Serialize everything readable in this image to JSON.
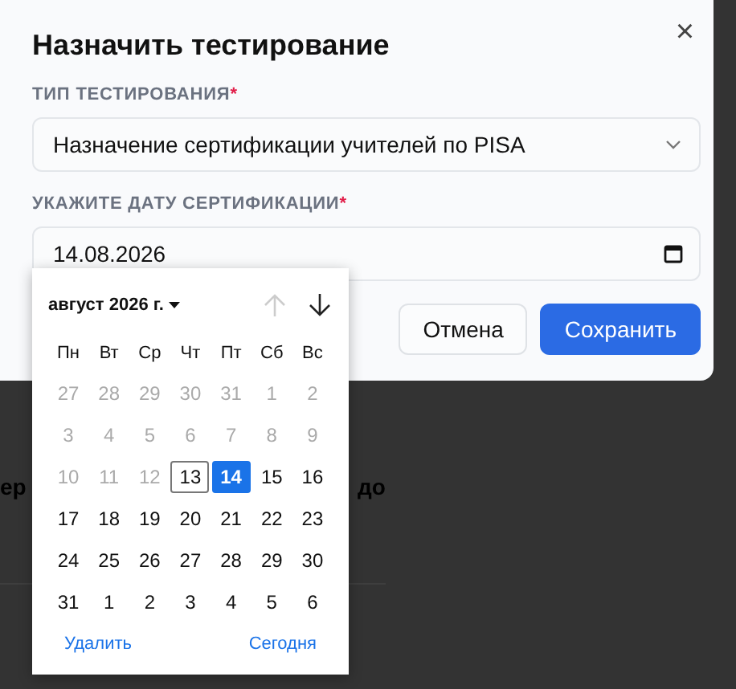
{
  "dialog": {
    "title": "Назначить тестирование",
    "close": "×",
    "fields": [
      {
        "label": "ТИП ТЕСТИРОВАНИЯ",
        "required_mark": "*",
        "kind": "select",
        "value": "Назначение сертификации учителей по PISA"
      },
      {
        "label": "УКАЖИТЕ ДАТУ СЕРТИФИКАЦИИ",
        "required_mark": "*",
        "kind": "date",
        "value": "14.08.2026"
      }
    ],
    "buttons": [
      {
        "label": "Отмена",
        "kind": "secondary"
      },
      {
        "label": "Сохранить",
        "kind": "primary"
      }
    ]
  },
  "background_text": [
    "ер",
    "до"
  ],
  "calendar": {
    "month": "август 2026 г.",
    "prev_disabled": true,
    "weekdays": [
      "Пн",
      "Вт",
      "Ср",
      "Чт",
      "Пт",
      "Сб",
      "Вс"
    ],
    "days": [
      {
        "label": "27",
        "muted": true,
        "today": false,
        "selected": false
      },
      {
        "label": "28",
        "muted": true,
        "today": false,
        "selected": false
      },
      {
        "label": "29",
        "muted": true,
        "today": false,
        "selected": false
      },
      {
        "label": "30",
        "muted": true,
        "today": false,
        "selected": false
      },
      {
        "label": "31",
        "muted": true,
        "today": false,
        "selected": false
      },
      {
        "label": "1",
        "muted": true,
        "today": false,
        "selected": false
      },
      {
        "label": "2",
        "muted": true,
        "today": false,
        "selected": false
      },
      {
        "label": "3",
        "muted": true,
        "today": false,
        "selected": false
      },
      {
        "label": "4",
        "muted": true,
        "today": false,
        "selected": false
      },
      {
        "label": "5",
        "muted": true,
        "today": false,
        "selected": false
      },
      {
        "label": "6",
        "muted": true,
        "today": false,
        "selected": false
      },
      {
        "label": "7",
        "muted": true,
        "today": false,
        "selected": false
      },
      {
        "label": "8",
        "muted": true,
        "today": false,
        "selected": false
      },
      {
        "label": "9",
        "muted": true,
        "today": false,
        "selected": false
      },
      {
        "label": "10",
        "muted": true,
        "today": false,
        "selected": false
      },
      {
        "label": "11",
        "muted": true,
        "today": false,
        "selected": false
      },
      {
        "label": "12",
        "muted": true,
        "today": false,
        "selected": false
      },
      {
        "label": "13",
        "muted": false,
        "today": true,
        "selected": false
      },
      {
        "label": "14",
        "muted": false,
        "today": false,
        "selected": true
      },
      {
        "label": "15",
        "muted": false,
        "today": false,
        "selected": false
      },
      {
        "label": "16",
        "muted": false,
        "today": false,
        "selected": false
      },
      {
        "label": "17",
        "muted": false,
        "today": false,
        "selected": false
      },
      {
        "label": "18",
        "muted": false,
        "today": false,
        "selected": false
      },
      {
        "label": "19",
        "muted": false,
        "today": false,
        "selected": false
      },
      {
        "label": "20",
        "muted": false,
        "today": false,
        "selected": false
      },
      {
        "label": "21",
        "muted": false,
        "today": false,
        "selected": false
      },
      {
        "label": "22",
        "muted": false,
        "today": false,
        "selected": false
      },
      {
        "label": "23",
        "muted": false,
        "today": false,
        "selected": false
      },
      {
        "label": "24",
        "muted": false,
        "today": false,
        "selected": false
      },
      {
        "label": "25",
        "muted": false,
        "today": false,
        "selected": false
      },
      {
        "label": "26",
        "muted": false,
        "today": false,
        "selected": false
      },
      {
        "label": "27",
        "muted": false,
        "today": false,
        "selected": false
      },
      {
        "label": "28",
        "muted": false,
        "today": false,
        "selected": false
      },
      {
        "label": "29",
        "muted": false,
        "today": false,
        "selected": false
      },
      {
        "label": "30",
        "muted": false,
        "today": false,
        "selected": false
      },
      {
        "label": "31",
        "muted": false,
        "today": false,
        "selected": false
      },
      {
        "label": "1",
        "muted": false,
        "today": false,
        "selected": false
      },
      {
        "label": "2",
        "muted": false,
        "today": false,
        "selected": false
      },
      {
        "label": "3",
        "muted": false,
        "today": false,
        "selected": false
      },
      {
        "label": "4",
        "muted": false,
        "today": false,
        "selected": false
      },
      {
        "label": "5",
        "muted": false,
        "today": false,
        "selected": false
      },
      {
        "label": "6",
        "muted": false,
        "today": false,
        "selected": false
      }
    ],
    "actions": [
      "Удалить",
      "Сегодня"
    ]
  }
}
